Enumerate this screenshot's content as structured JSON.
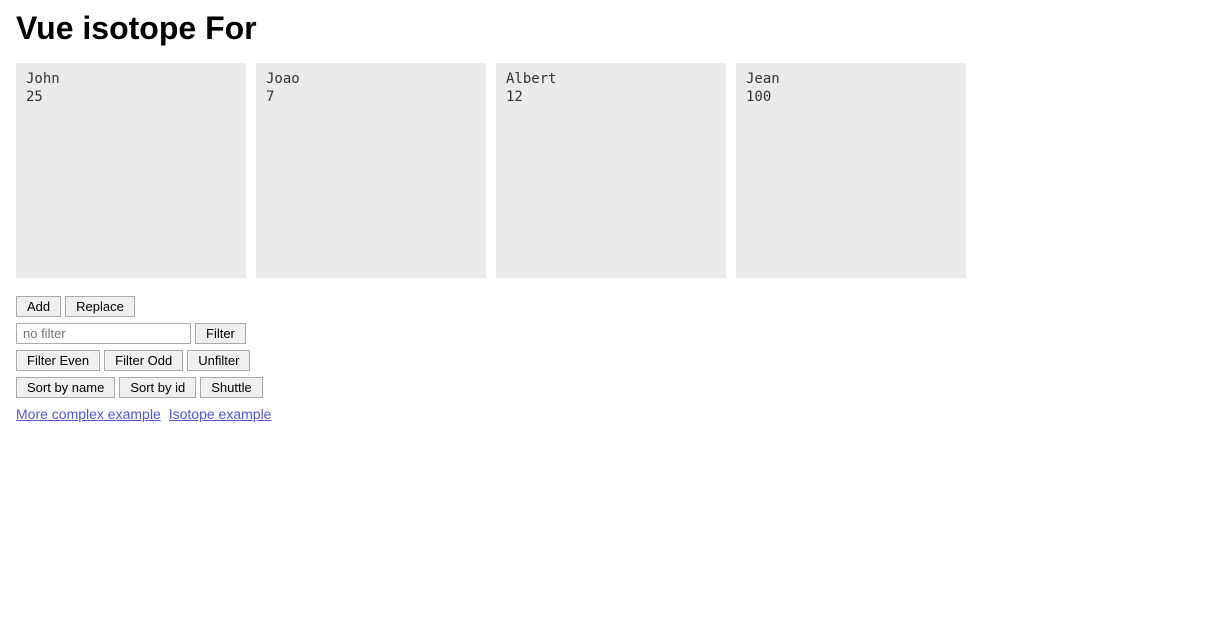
{
  "page": {
    "title": "Vue isotope For"
  },
  "cards": [
    {
      "name": "John",
      "id": "25"
    },
    {
      "name": "Joao",
      "id": "7"
    },
    {
      "name": "Albert",
      "id": "12"
    },
    {
      "name": "Jean",
      "id": "100"
    }
  ],
  "controls": {
    "add_label": "Add",
    "replace_label": "Replace",
    "filter_input_placeholder": "no filter",
    "filter_button_label": "Filter",
    "filter_even_label": "Filter Even",
    "filter_odd_label": "Filter Odd",
    "unfilter_label": "Unfilter",
    "sort_by_name_label": "Sort by name",
    "sort_by_id_label": "Sort by id",
    "shuttle_label": "Shuttle"
  },
  "links": [
    {
      "text": "More complex example",
      "href": "#"
    },
    {
      "text": "Isotope example",
      "href": "#"
    }
  ]
}
